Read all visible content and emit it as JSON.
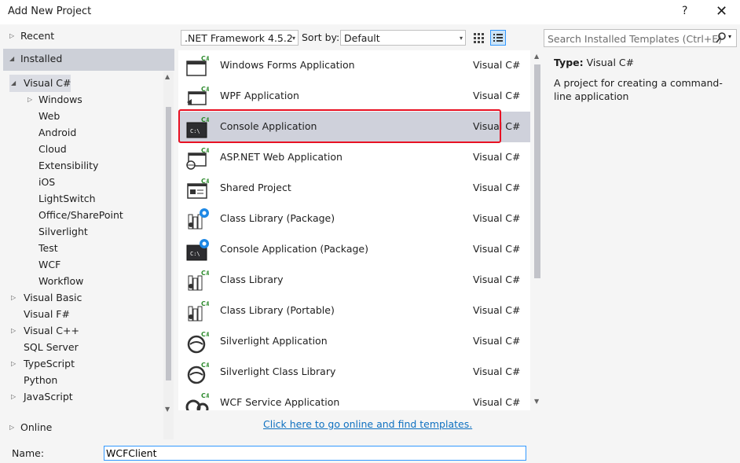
{
  "window": {
    "title": "Add New Project",
    "help": "?",
    "close": "✕"
  },
  "left_nav": {
    "recent": "Recent",
    "installed": "Installed",
    "tree": [
      {
        "label": "Visual C#",
        "level": 1,
        "toggle": "expanded"
      },
      {
        "label": "Windows",
        "level": 2,
        "toggle": "collapsed"
      },
      {
        "label": "Web",
        "level": 2,
        "toggle": "none"
      },
      {
        "label": "Android",
        "level": 2,
        "toggle": "none"
      },
      {
        "label": "Cloud",
        "level": 2,
        "toggle": "none"
      },
      {
        "label": "Extensibility",
        "level": 2,
        "toggle": "none"
      },
      {
        "label": "iOS",
        "level": 2,
        "toggle": "none"
      },
      {
        "label": "LightSwitch",
        "level": 2,
        "toggle": "none"
      },
      {
        "label": "Office/SharePoint",
        "level": 2,
        "toggle": "none"
      },
      {
        "label": "Silverlight",
        "level": 2,
        "toggle": "none"
      },
      {
        "label": "Test",
        "level": 2,
        "toggle": "none"
      },
      {
        "label": "WCF",
        "level": 2,
        "toggle": "none"
      },
      {
        "label": "Workflow",
        "level": 2,
        "toggle": "none"
      },
      {
        "label": "Visual Basic",
        "level": 1,
        "toggle": "collapsed"
      },
      {
        "label": "Visual F#",
        "level": 1,
        "toggle": "none"
      },
      {
        "label": "Visual C++",
        "level": 1,
        "toggle": "collapsed"
      },
      {
        "label": "SQL Server",
        "level": 1,
        "toggle": "none"
      },
      {
        "label": "TypeScript",
        "level": 1,
        "toggle": "collapsed"
      },
      {
        "label": "Python",
        "level": 1,
        "toggle": "none"
      },
      {
        "label": "JavaScript",
        "level": 1,
        "toggle": "collapsed"
      }
    ],
    "online": "Online"
  },
  "toolbar": {
    "framework": ".NET Framework 4.5.2",
    "sort_label": "Sort by:",
    "sort_value": "Default"
  },
  "templates": [
    {
      "name": "Windows Forms Application",
      "lang": "Visual C#",
      "icon": "winforms-icon",
      "selected": false
    },
    {
      "name": "WPF Application",
      "lang": "Visual C#",
      "icon": "wpf-icon",
      "selected": false
    },
    {
      "name": "Console Application",
      "lang": "Visual C#",
      "icon": "console-icon",
      "selected": true
    },
    {
      "name": "ASP.NET Web Application",
      "lang": "Visual C#",
      "icon": "web-app-icon",
      "selected": false
    },
    {
      "name": "Shared Project",
      "lang": "Visual C#",
      "icon": "shared-project-icon",
      "selected": false
    },
    {
      "name": "Class Library (Package)",
      "lang": "Visual C#",
      "icon": "class-library-package-icon",
      "selected": false
    },
    {
      "name": "Console Application (Package)",
      "lang": "Visual C#",
      "icon": "console-package-icon",
      "selected": false
    },
    {
      "name": "Class Library",
      "lang": "Visual C#",
      "icon": "class-library-icon",
      "selected": false
    },
    {
      "name": "Class Library (Portable)",
      "lang": "Visual C#",
      "icon": "class-library-portable-icon",
      "selected": false
    },
    {
      "name": "Silverlight Application",
      "lang": "Visual C#",
      "icon": "silverlight-icon",
      "selected": false
    },
    {
      "name": "Silverlight Class Library",
      "lang": "Visual C#",
      "icon": "silverlight-library-icon",
      "selected": false
    },
    {
      "name": "WCF Service Application",
      "lang": "Visual C#",
      "icon": "wcf-service-icon",
      "selected": false
    }
  ],
  "search": {
    "placeholder": "Search Installed Templates (Ctrl+E)"
  },
  "details": {
    "type_label": "Type:",
    "type_value": "Visual C#",
    "description": "A project for creating a command-line application"
  },
  "online_link": "Click here to go online and find templates.",
  "name_field": {
    "label": "Name:",
    "value": "WCFClient"
  },
  "colors": {
    "selection": "#cfd1db",
    "highlight_box": "#e81123",
    "link": "#0e70c0",
    "csharp_badge": "#2c8a2c"
  }
}
